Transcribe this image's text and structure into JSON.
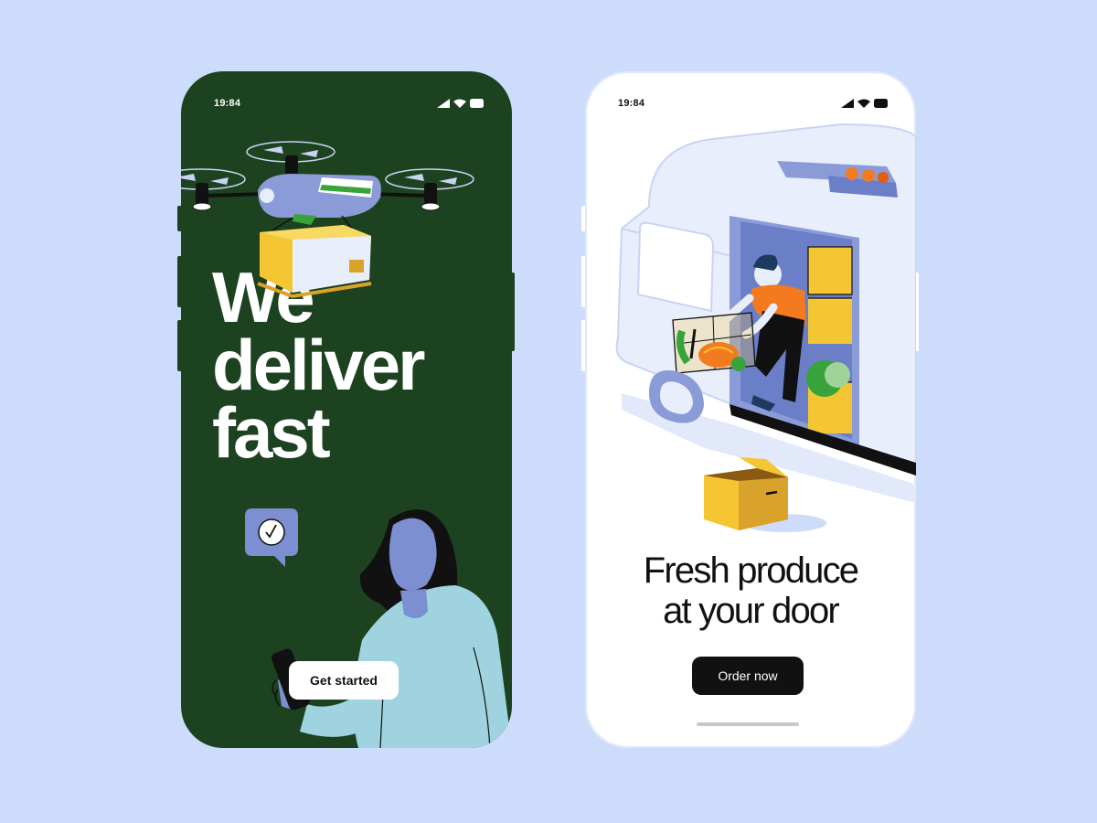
{
  "colors": {
    "background": "#cddcfb",
    "phone_green": "#1d4220",
    "phone_white": "#ffffff",
    "accent_yellow": "#f5c633",
    "accent_orange": "#f47a1f",
    "lilac": "#8b9bd8"
  },
  "screen_left": {
    "status_time": "19:84",
    "headline_lines": [
      "We",
      "deliver",
      "fast"
    ],
    "cta_label": "Get started",
    "icons": [
      "signal-icon",
      "wifi-icon",
      "battery-icon",
      "drone-illustration",
      "chat-check-icon",
      "woman-with-phone-illustration"
    ]
  },
  "screen_right": {
    "status_time": "19:84",
    "subtitle_lines": [
      "Fresh produce",
      "at your door"
    ],
    "cta_label": "Order now",
    "icons": [
      "signal-icon",
      "wifi-icon",
      "battery-icon",
      "delivery-van-illustration",
      "open-box-illustration"
    ]
  }
}
